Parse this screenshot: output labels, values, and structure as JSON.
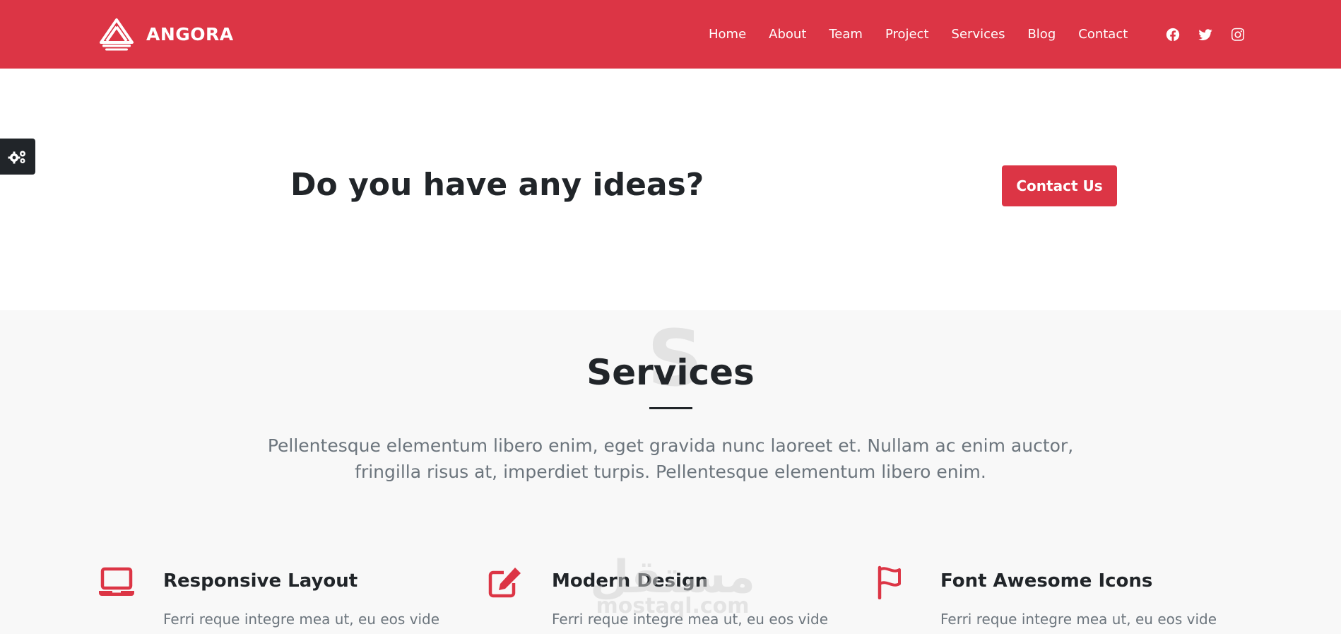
{
  "header": {
    "brand": "ANGORA",
    "nav": [
      "Home",
      "About",
      "Team",
      "Project",
      "Services",
      "Blog",
      "Contact"
    ],
    "social_icons": [
      "facebook-icon",
      "twitter-icon",
      "instagram-icon"
    ]
  },
  "settings_icon": "gears-icon",
  "cta": {
    "heading": "Do you have any ideas?",
    "button": "Contact Us"
  },
  "services": {
    "bg_letter": "S",
    "title": "Services",
    "description_line1": "Pellentesque elementum libero enim, eget gravida nunc laoreet et. Nullam ac enim auctor,",
    "description_line2": "fringilla risus at, imperdiet turpis. Pellentesque elementum libero enim.",
    "items": [
      {
        "icon": "laptop-icon",
        "title": "Responsive Layout",
        "text": "Ferri reque integre mea ut, eu eos vide"
      },
      {
        "icon": "edit-icon",
        "title": "Modern Design",
        "text": "Ferri reque integre mea ut, eu eos vide"
      },
      {
        "icon": "flag-icon",
        "title": "Font Awesome Icons",
        "text": "Ferri reque integre mea ut, eu eos vide"
      }
    ]
  },
  "watermark": {
    "arabic": "مستقل",
    "latin": "mostaql.com"
  },
  "colors": {
    "primary": "#dc3545",
    "dark": "#212529",
    "muted": "#6c757d",
    "section_bg": "#f8f8f8"
  }
}
